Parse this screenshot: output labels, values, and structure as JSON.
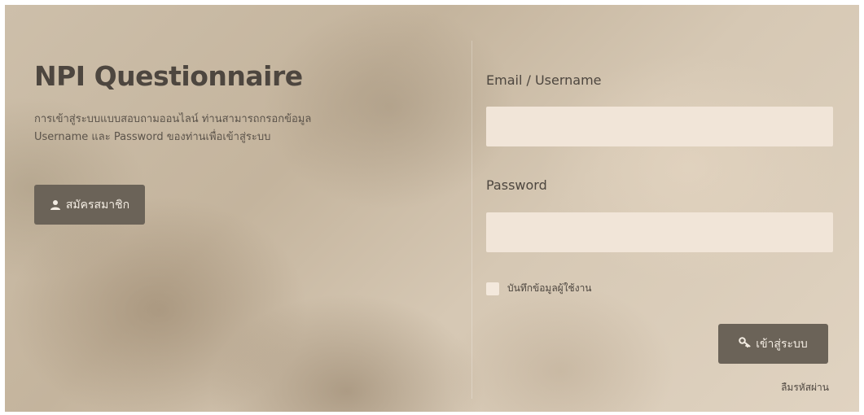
{
  "app": {
    "title": "NPI Questionnaire",
    "description_lines": [
      "การเข้าสู่ระบบแบบสอบถามออนไลน์ ท่านสามารถกรอกข้อมูล",
      "Username และ Password ของท่านเพื่อเข้าสู่ระบบ"
    ]
  },
  "register": {
    "label": "สมัครสมาชิก",
    "icon": "user-icon"
  },
  "form": {
    "email_label": "Email / Username",
    "email_value": "",
    "password_label": "Password",
    "password_value": "",
    "remember_label": "บันทึกข้อมูลผู้ใช้งาน",
    "remember_checked": false,
    "login_label": "เข้าสู่ระบบ",
    "login_icon": "key-icon",
    "forgot_label": "ลืมรหัสผ่าน"
  },
  "colors": {
    "button": "#6b6358",
    "input_bg": "#f1e5d8",
    "text": "#4d463f"
  }
}
